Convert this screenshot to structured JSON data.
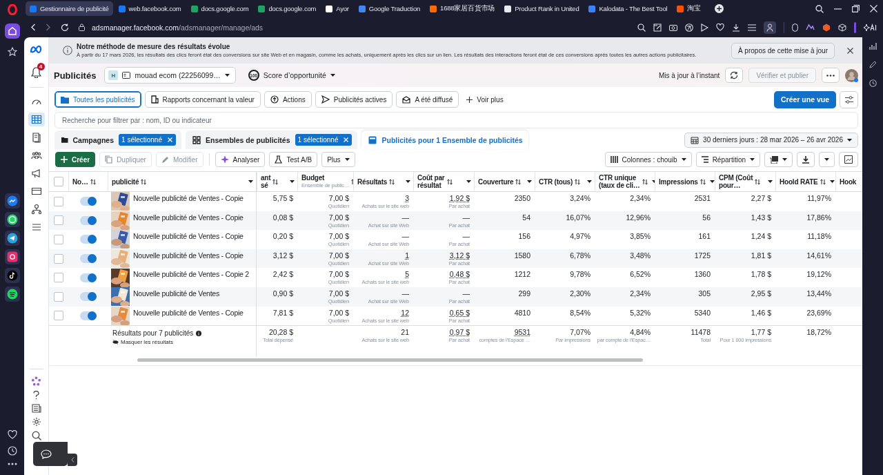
{
  "browser": {
    "tabs": [
      {
        "title": "Gestionnaire de publicité",
        "color": "#1877f2",
        "selected": true
      },
      {
        "title": "web.facebook.com",
        "color": "#1877f2",
        "selected": false
      },
      {
        "title": "docs.google.com",
        "color": "#1ea362",
        "selected": false
      },
      {
        "title": "docs.google.com",
        "color": "#1ea362",
        "selected": false
      },
      {
        "title": "Ayor",
        "color": "#ffffff",
        "selected": false
      },
      {
        "title": "Google Traduction",
        "color": "#4285f4",
        "selected": false
      },
      {
        "title": "1688家居百货市场",
        "color": "#ff6a00",
        "selected": false
      },
      {
        "title": "Product Rank in United",
        "color": "#e8eaf0",
        "selected": false
      },
      {
        "title": "Kalodata - The Best Tool",
        "color": "#3b82f6",
        "selected": false
      },
      {
        "title": "淘宝",
        "color": "#ff5000",
        "selected": false
      }
    ],
    "url_host": "adsmanager.facebook.com",
    "url_path": "/adsmanager/manage/ads"
  },
  "nav": [
    {
      "kind": "gauge",
      "selected": false
    },
    {
      "kind": "table",
      "selected": true
    },
    {
      "kind": "pages",
      "selected": false
    },
    {
      "kind": "people",
      "selected": false
    },
    {
      "kind": "megaphone",
      "selected": false
    },
    {
      "kind": "card",
      "selected": false
    },
    {
      "kind": "network",
      "selected": false
    },
    {
      "kind": "menu",
      "selected": false
    }
  ],
  "notifications": "4",
  "banner": {
    "title": "Notre méthode de mesure des résultats évolue",
    "text": "À partir du 17 mars 2026, les résultats des clics feront état des conversions sur site Web et en magasin, comme les achats, uniquement après les clics sur un lien. Les résultats des interactions feront état de ces conversions après toutes les autres actions publicitaires.",
    "button": "À propos de cette mise à jour"
  },
  "header": {
    "title": "Publicités",
    "account_initial": "H",
    "account": "mouad ecom (22256099…",
    "score": "100",
    "score_label": "Score d’opportunité",
    "status": "Mis à jour à l’instant",
    "publish_button": "Vérifier et publier"
  },
  "view_tabs": [
    {
      "label": "Toutes les publicités",
      "kind": "folder",
      "selected": true
    },
    {
      "label": "Rapports concernant la valeur",
      "kind": "report",
      "selected": false
    },
    {
      "label": "Actions",
      "kind": "upload",
      "selected": false
    },
    {
      "label": "Publicités actives",
      "kind": "send",
      "selected": false
    },
    {
      "label": "A été diffusé",
      "kind": "mail",
      "selected": false
    }
  ],
  "more_views": "Voir plus",
  "create_view": "Créer une vue",
  "search": {
    "placeholder": "Recherche pour filtrer par : nom, ID ou indicateur"
  },
  "level_tabs": [
    {
      "label": "Campagnes",
      "kind": "folder",
      "badge": "1 sélectionné",
      "selected": false
    },
    {
      "label": "Ensembles de publicités",
      "kind": "grid",
      "badge": "1 sélectionné",
      "selected": false
    },
    {
      "label": "Publicités pour 1 Ensemble de publicités",
      "kind": "ad",
      "selected": true
    }
  ],
  "date_range": "30 derniers jours : 28 mar 2026 – 26 avr 2026",
  "toolbar": [
    {
      "label": "Créer",
      "kind": "create",
      "disabled": false
    },
    {
      "label": "Dupliquer",
      "kind": "copy",
      "disabled": true
    },
    {
      "label": "Modifier",
      "kind": "edit",
      "disabled": true
    },
    {
      "label": "Analyser",
      "kind": "analyze",
      "disabled": false
    },
    {
      "label": "Test A/B",
      "kind": "test",
      "disabled": false
    },
    {
      "label": "Plus",
      "kind": "more",
      "disabled": false
    }
  ],
  "columns_button": "Colonnes : chouib",
  "breakdown_button": "Répartition",
  "table": {
    "select_all": false,
    "fixed_columns": [
      {
        "lines": [
          "No…"
        ]
      },
      {
        "lines": [
          "publicité"
        ]
      }
    ],
    "columns": [
      {
        "lines": [
          "ant",
          "sé"
        ]
      },
      {
        "lines": [
          "Budget"
        ],
        "sub": "Ensemble de public…"
      },
      {
        "lines": [
          "Résultats"
        ]
      },
      {
        "lines": [
          "Coût par",
          "résultat"
        ]
      },
      {
        "lines": [
          "Couverture"
        ]
      },
      {
        "lines": [
          "CTR (tous)"
        ]
      },
      {
        "lines": [
          "CTR unique",
          "(taux de cli…"
        ]
      },
      {
        "lines": [
          "Impressions"
        ]
      },
      {
        "lines": [
          "CPM (Coût",
          "pour…"
        ]
      },
      {
        "lines": [
          "Hoold RATE"
        ]
      },
      {
        "lines": [
          "Hook"
        ]
      }
    ],
    "rows": [
      {
        "selected": false,
        "on": true,
        "name": "Nouvelle publicité de Ventes - Copie",
        "cells": [
          {
            "text": "5,75 $"
          },
          {
            "text": "7,00 $",
            "sub": "Quotidien"
          },
          {
            "text": "3",
            "sub": "Achats sur le site web",
            "link": true
          },
          {
            "text": "1,92 $",
            "sub": "Par achat",
            "link": true
          },
          {
            "text": "2350"
          },
          {
            "text": "3,24%"
          },
          {
            "text": "2,34%"
          },
          {
            "text": "2531"
          },
          {
            "text": "2,27 $"
          },
          {
            "text": "11,97%"
          }
        ]
      },
      {
        "selected": false,
        "on": true,
        "name": "Nouvelle publicité de Ventes - Copie",
        "cells": [
          {
            "text": "0,08 $"
          },
          {
            "text": "7,00 $",
            "sub": "Quotidien"
          },
          {
            "text": "—",
            "sub": "Achat sur site Web"
          },
          {
            "text": "—",
            "sub": "Par achat"
          },
          {
            "text": "54"
          },
          {
            "text": "16,07%"
          },
          {
            "text": "12,96%"
          },
          {
            "text": "56"
          },
          {
            "text": "1,43 $"
          },
          {
            "text": "17,86%"
          }
        ]
      },
      {
        "selected": false,
        "on": true,
        "name": "Nouvelle publicité de Ventes - Copie",
        "cells": [
          {
            "text": "0,20 $"
          },
          {
            "text": "7,00 $",
            "sub": "Quotidien"
          },
          {
            "text": "—",
            "sub": "Achat sur site Web"
          },
          {
            "text": "—",
            "sub": "Par achat"
          },
          {
            "text": "156"
          },
          {
            "text": "4,97%"
          },
          {
            "text": "3,85%"
          },
          {
            "text": "161"
          },
          {
            "text": "1,24 $"
          },
          {
            "text": "11,18%"
          }
        ]
      },
      {
        "selected": false,
        "on": true,
        "name": "Nouvelle publicité de Ventes - Copie",
        "cells": [
          {
            "text": "3,12 $"
          },
          {
            "text": "7,00 $",
            "sub": "Quotidien"
          },
          {
            "text": "1",
            "sub": "Achat sur site Web",
            "link": true
          },
          {
            "text": "3,12 $",
            "sub": "Par achat",
            "link": true
          },
          {
            "text": "1580"
          },
          {
            "text": "6,78%"
          },
          {
            "text": "3,48%"
          },
          {
            "text": "1725"
          },
          {
            "text": "1,81 $"
          },
          {
            "text": "14,61%"
          }
        ]
      },
      {
        "selected": false,
        "on": true,
        "name": "Nouvelle publicité de Ventes - Copie 2",
        "cells": [
          {
            "text": "2,42 $"
          },
          {
            "text": "7,00 $",
            "sub": "Quotidien"
          },
          {
            "text": "5",
            "sub": "Achats sur le site web",
            "link": true
          },
          {
            "text": "0,48 $",
            "sub": "Par achat",
            "link": true
          },
          {
            "text": "1212"
          },
          {
            "text": "9,78%"
          },
          {
            "text": "6,52%"
          },
          {
            "text": "1360"
          },
          {
            "text": "1,78 $"
          },
          {
            "text": "19,12%"
          }
        ]
      },
      {
        "selected": false,
        "on": true,
        "name": "Nouvelle publicité de Ventes",
        "cells": [
          {
            "text": "0,90 $"
          },
          {
            "text": "7,00 $",
            "sub": "Quotidien"
          },
          {
            "text": "—",
            "sub": "Achat sur site Web"
          },
          {
            "text": "—",
            "sub": "Par achat"
          },
          {
            "text": "299"
          },
          {
            "text": "2,30%"
          },
          {
            "text": "2,34%"
          },
          {
            "text": "305"
          },
          {
            "text": "2,95 $"
          },
          {
            "text": "13,44%"
          }
        ]
      },
      {
        "selected": false,
        "on": true,
        "name": "Nouvelle publicité de Ventes - Copie",
        "cells": [
          {
            "text": "7,81 $"
          },
          {
            "text": "7,00 $",
            "sub": "Quotidien"
          },
          {
            "text": "12",
            "sub": "Achats sur le site web",
            "link": true
          },
          {
            "text": "0,65 $",
            "sub": "Par achat",
            "link": true
          },
          {
            "text": "4810"
          },
          {
            "text": "8,54%"
          },
          {
            "text": "5,32%"
          },
          {
            "text": "5340"
          },
          {
            "text": "1,46 $"
          },
          {
            "text": "23,69%"
          }
        ]
      }
    ],
    "summary": {
      "label": "Résultats pour 7 publicités",
      "hide": "Masquer les résultats",
      "cells": [
        {
          "text": "20,28 $",
          "sub": "Total dépensé"
        },
        null,
        {
          "text": "21",
          "sub": "Achats sur le site web"
        },
        {
          "text": "0,97 $",
          "sub": "Par achat",
          "link": true
        },
        {
          "text": "9531",
          "sub": "comptes de l’Espace …",
          "link": true
        },
        {
          "text": "7,07%",
          "sub": "Par impressions"
        },
        {
          "text": "4,84%",
          "sub": "par compte de l’Espac…"
        },
        {
          "text": "11478",
          "sub": "Total"
        },
        {
          "text": "1,77 $",
          "sub": "Pour 1 000 impressions"
        },
        {
          "text": "18,72%"
        }
      ]
    }
  }
}
